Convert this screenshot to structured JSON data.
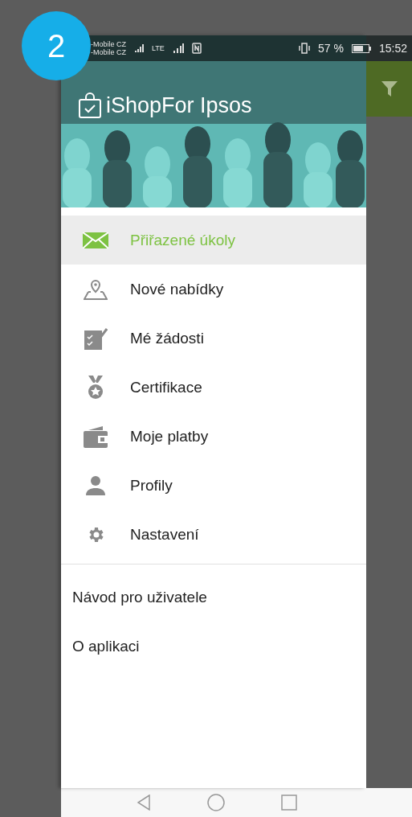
{
  "step_badge": "2",
  "status_bar": {
    "carriers": [
      "-Mobile CZ",
      "-Mobile CZ"
    ],
    "network": "LTE",
    "battery": "57 %",
    "time": "15:52"
  },
  "header": {
    "title": "iShopFor Ipsos"
  },
  "menu": [
    {
      "label": "Přiřazené úkoly",
      "kind": "mail",
      "selected": true
    },
    {
      "label": "Nové nabídky",
      "kind": "pin",
      "selected": false
    },
    {
      "label": "Mé žádosti",
      "kind": "checklist",
      "selected": false
    },
    {
      "label": "Certifikace",
      "kind": "medal",
      "selected": false
    },
    {
      "label": "Moje platby",
      "kind": "wallet",
      "selected": false
    },
    {
      "label": "Profily",
      "kind": "person",
      "selected": false
    },
    {
      "label": "Nastavení",
      "kind": "gear",
      "selected": false
    }
  ],
  "secondary_links": [
    "Návod pro uživatele",
    "O aplikaci"
  ]
}
